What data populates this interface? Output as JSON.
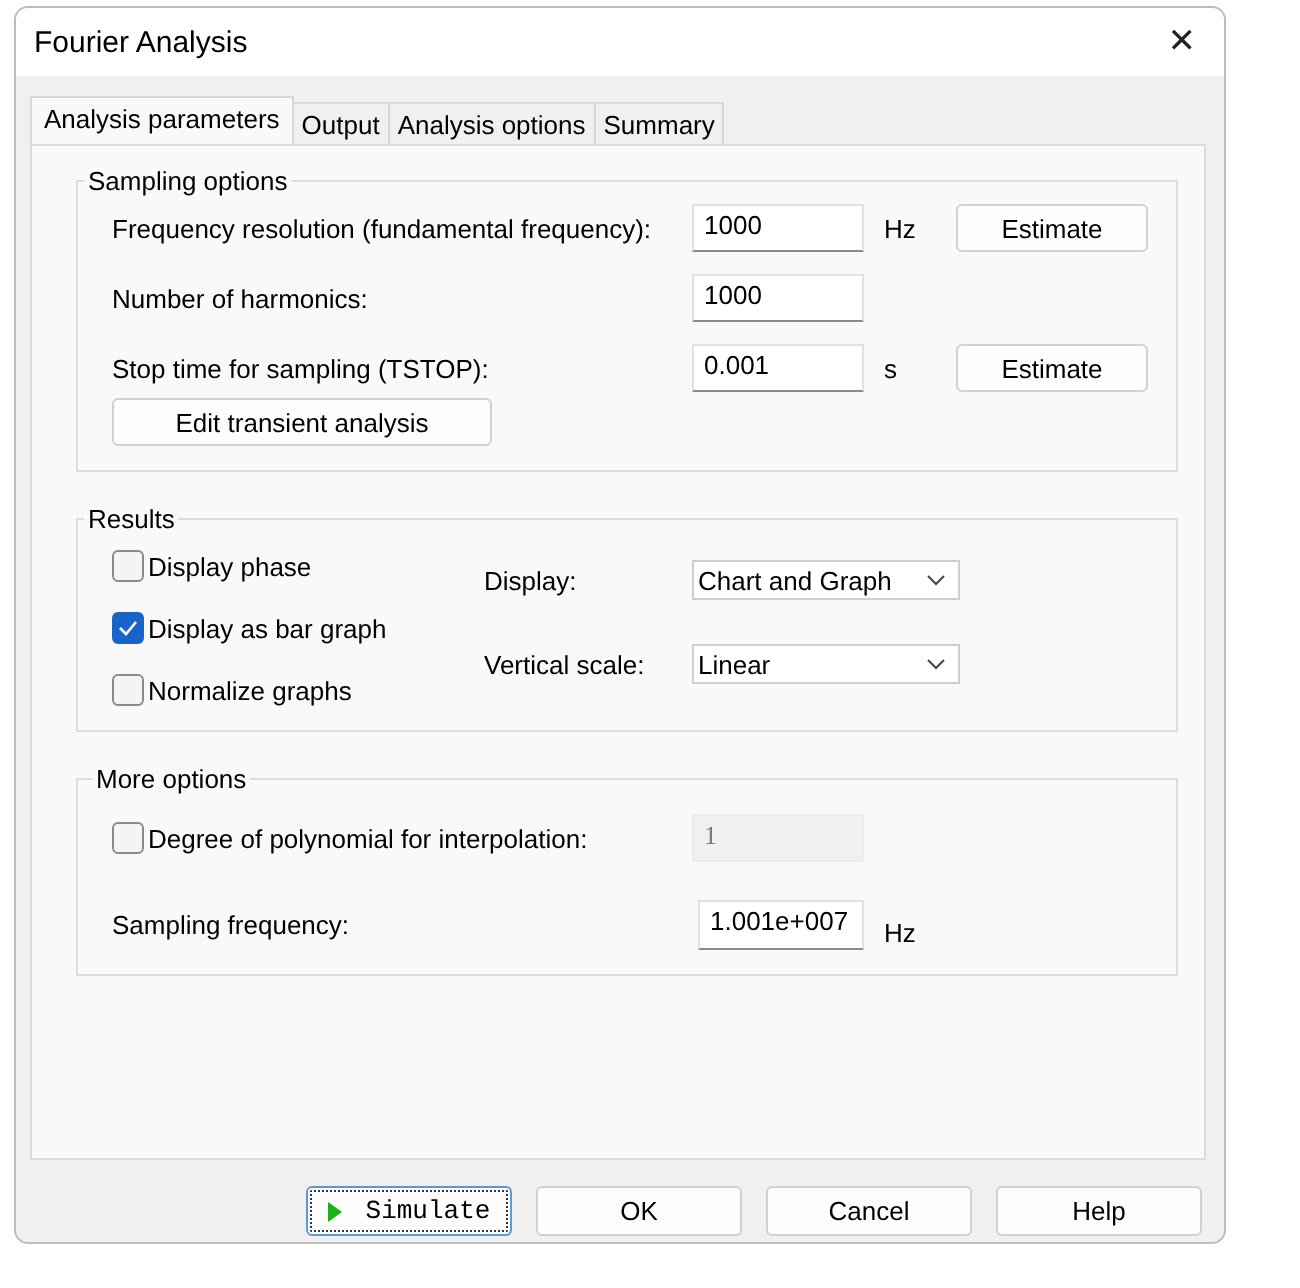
{
  "window": {
    "title": "Fourier Analysis",
    "close": "✕"
  },
  "tabs": [
    {
      "label": "Analysis parameters",
      "selected": true
    },
    {
      "label": "Output",
      "selected": false
    },
    {
      "label": "Analysis options",
      "selected": false
    },
    {
      "label": "Summary",
      "selected": false
    }
  ],
  "sampling": {
    "title": "Sampling options",
    "rows": [
      {
        "label": "Frequency resolution (fundamental frequency):",
        "value": "1000",
        "unit": "Hz",
        "button": "Estimate"
      },
      {
        "label": "Number of harmonics:",
        "value": "1000"
      },
      {
        "label": "Stop time for sampling (TSTOP):",
        "value": "0.001",
        "unit": "s",
        "button": "Estimate"
      }
    ],
    "edit_button": "Edit transient analysis"
  },
  "results": {
    "title": "Results",
    "checkboxes": [
      {
        "label": "Display phase",
        "checked": false
      },
      {
        "label": "Display as bar graph",
        "checked": true
      },
      {
        "label": "Normalize graphs",
        "checked": false
      }
    ],
    "selects": [
      {
        "label": "Display:",
        "value": "Chart and Graph"
      },
      {
        "label": "Vertical scale:",
        "value": "Linear"
      }
    ]
  },
  "more": {
    "title": "More options",
    "rows": [
      {
        "kind": "checkbox",
        "label": "Degree of polynomial for interpolation:",
        "checked": false,
        "value": "1",
        "disabled": true
      },
      {
        "kind": "field",
        "label": "Sampling frequency:",
        "value": "1.001e+007",
        "unit": "Hz",
        "disabled": false
      }
    ]
  },
  "buttons": [
    {
      "label": "Simulate",
      "kind": "simulate",
      "focused": true
    },
    {
      "label": "OK",
      "kind": "plain",
      "focused": false
    },
    {
      "label": "Cancel",
      "kind": "plain",
      "focused": false
    },
    {
      "label": "Help",
      "kind": "plain",
      "focused": false
    }
  ]
}
